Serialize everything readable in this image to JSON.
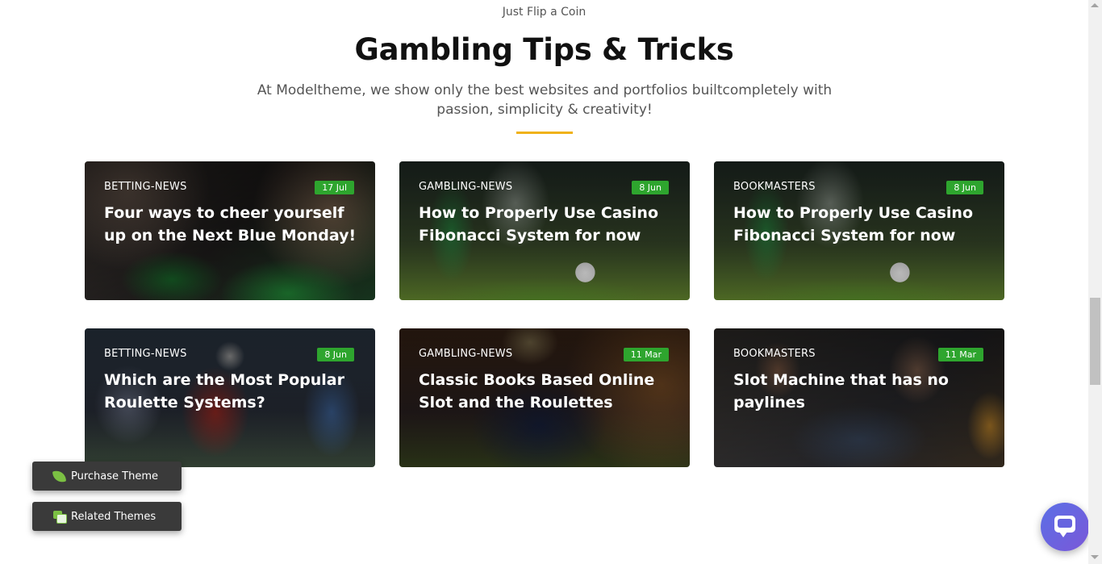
{
  "header": {
    "kicker": "Just Flip a Coin",
    "title": "Gambling Tips & Tricks",
    "subtitle": "At Modeltheme, we show only the best websites and portfolios builtcompletely with passion, simplicity & creativity!",
    "accent_color": "#f0b21a"
  },
  "posts": [
    {
      "category": "BETTING-NEWS",
      "date": "17 Jul",
      "title": "Four ways to cheer yourself up on the Next Blue Monday!",
      "scene": "poker-table-image"
    },
    {
      "category": "GAMBLING-NEWS",
      "date": "8 Jun",
      "title": "How to Properly Use Casino Fibonacci System for now",
      "scene": "soccer-match-image"
    },
    {
      "category": "BOOKMASTERS",
      "date": "8 Jun",
      "title": "How to Properly Use Casino Fibonacci System for now",
      "scene": "soccer-match-image"
    },
    {
      "category": "BETTING-NEWS",
      "date": "8 Jun",
      "title": "Which are the Most Popular Roulette Systems?",
      "scene": "football-players-image"
    },
    {
      "category": "GAMBLING-NEWS",
      "date": "11 Mar",
      "title": "Classic Books Based Online Slot and the Roulettes",
      "scene": "man-in-suit-image"
    },
    {
      "category": "BOOKMASTERS",
      "date": "11 Mar",
      "title": "Slot Machine that has no paylines",
      "scene": "sports-bar-image"
    }
  ],
  "date_badge_color": "#2ea52e",
  "floating": {
    "purchase_label": "Purchase Theme",
    "related_label": "Related Themes",
    "purchase_icon": "leaf-icon",
    "related_icon": "stacked-cards-icon"
  },
  "chat": {
    "icon": "chat-bubble-icon",
    "color": "#6764df"
  }
}
